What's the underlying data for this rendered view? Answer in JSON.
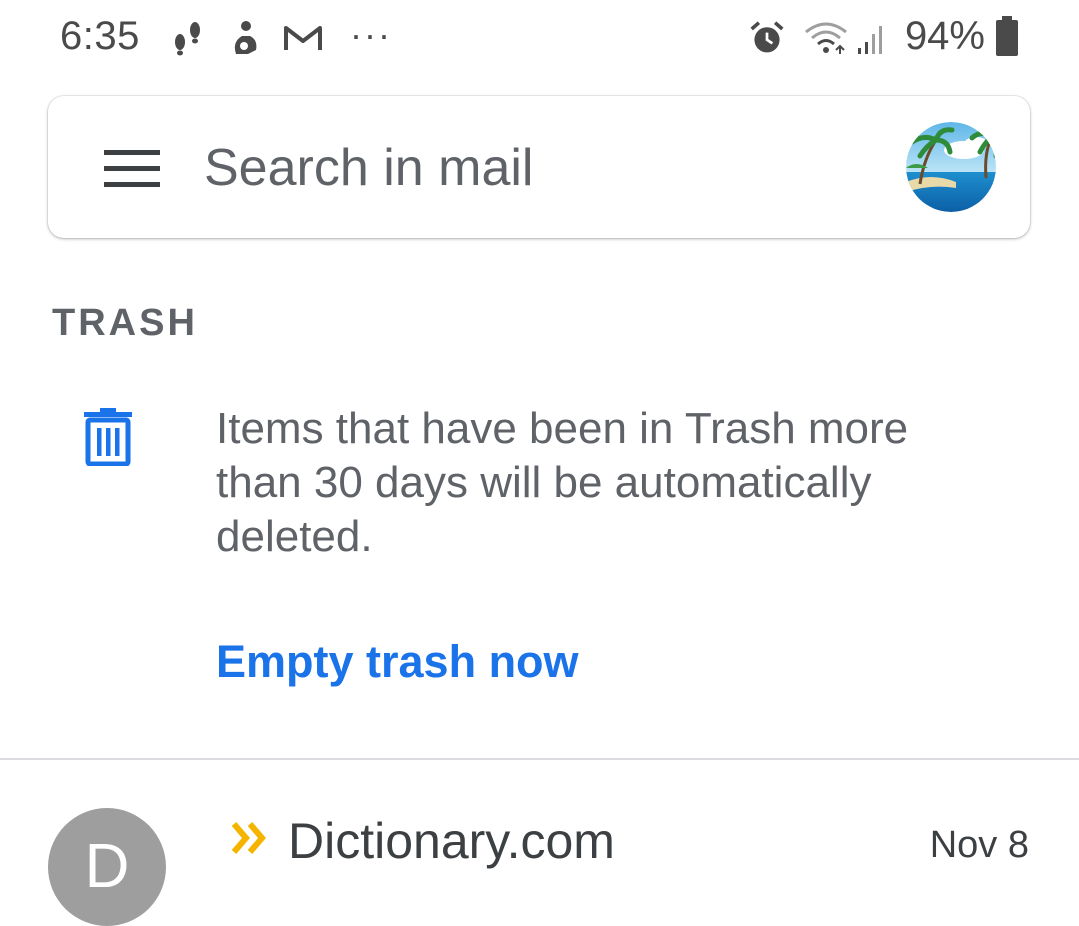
{
  "status_bar": {
    "time": "6:35",
    "notification_icons": [
      "steps-icon",
      "activity-icon",
      "gmail-icon",
      "more-notifications-icon"
    ],
    "system_icons": [
      "alarm-icon",
      "wifi-icon",
      "signal-icon",
      "battery-icon"
    ],
    "battery_percent": "94%",
    "more_glyph": "···"
  },
  "search": {
    "placeholder": "Search in mail"
  },
  "section": {
    "title": "TRASH"
  },
  "trash_notice": {
    "message": "Items that have been in Trash more than 30 days will be automatically deleted.",
    "action_label": "Empty trash now"
  },
  "emails": [
    {
      "avatar_letter": "D",
      "sender": "Dictionary.com",
      "date": "Nov 8",
      "important": true
    }
  ],
  "colors": {
    "accent_blue": "#1a73e8",
    "importance_yellow": "#f4b400",
    "avatar_gray": "#9e9e9e"
  }
}
